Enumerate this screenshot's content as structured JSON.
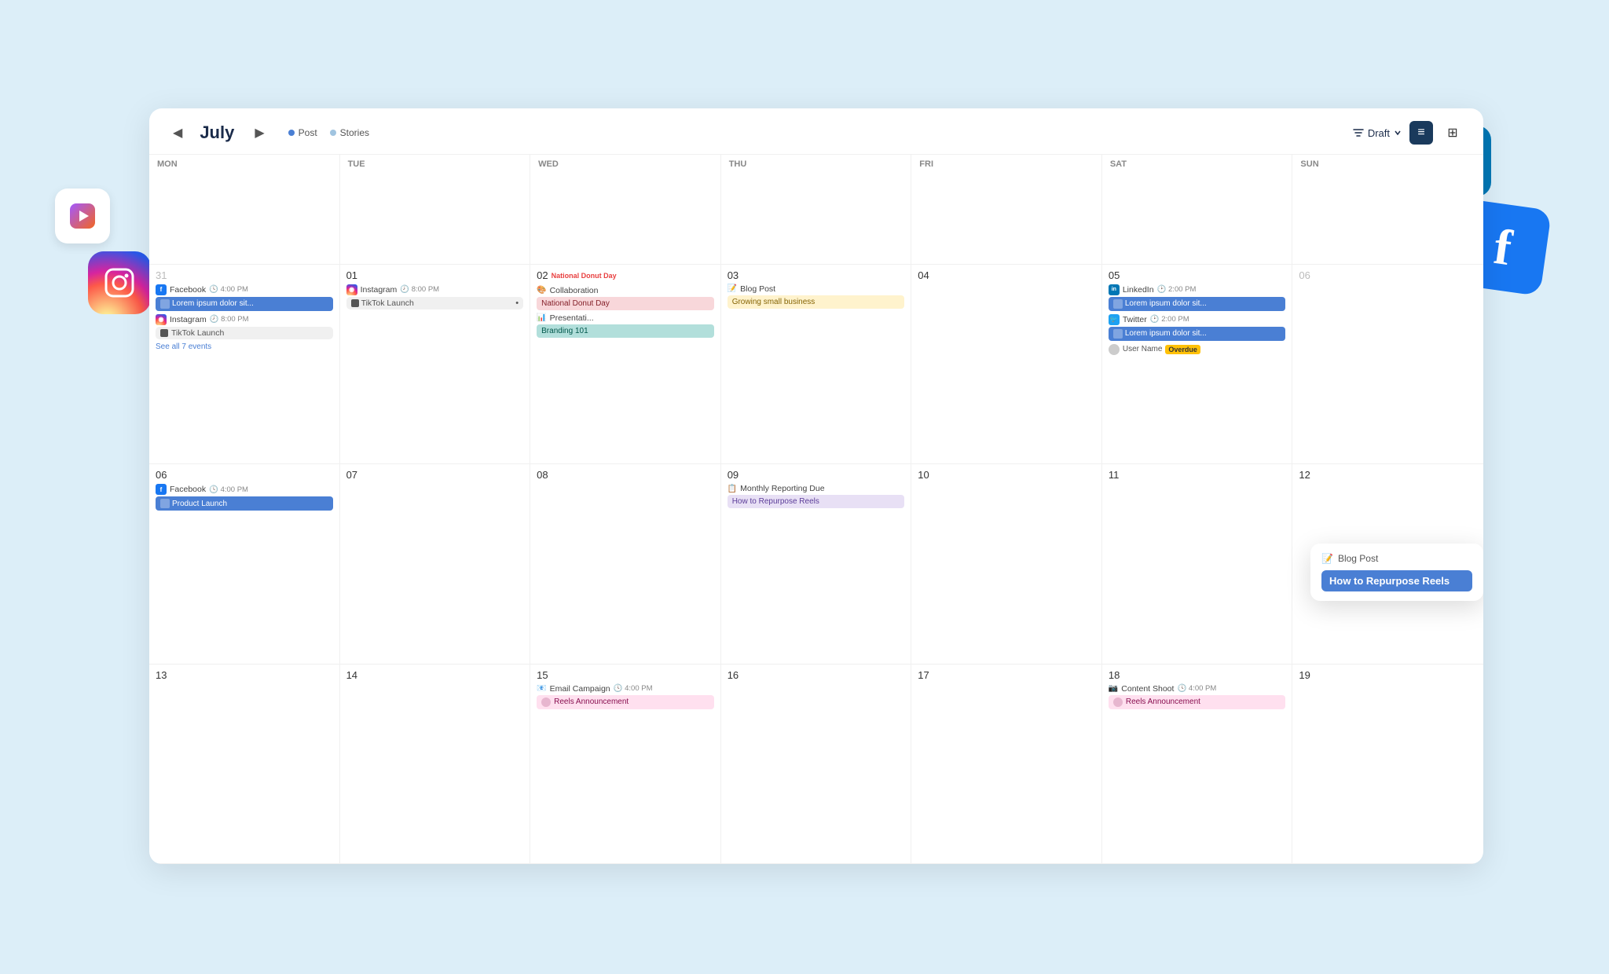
{
  "page": {
    "bg_color": "#dceef8"
  },
  "header": {
    "month": "July",
    "nav_prev": "◀",
    "nav_next": "▶",
    "legend": [
      {
        "label": "Post",
        "color": "#4a7fd4"
      },
      {
        "label": "Stories",
        "color": "#a0c4e0"
      }
    ],
    "filter_label": "Draft",
    "view_list": "≡",
    "view_grid": "⊞"
  },
  "days_of_week": [
    "Mon",
    "Tue",
    "Wed",
    "Thu",
    "Fri",
    "Sat",
    "Sun"
  ],
  "calendar": {
    "week1": {
      "mon": {
        "num": "31",
        "muted": true,
        "events": [
          {
            "platform": "Facebook",
            "time": "4:00 PM",
            "pill": "Lorem ipsum dolor sit...",
            "pill_type": "blue"
          },
          {
            "platform": "Instagram",
            "time": "8:00 PM"
          },
          {
            "subitem": "TikTok Launch"
          }
        ],
        "see_all": "See all 7 events"
      },
      "tue": {
        "num": "01",
        "events": [
          {
            "platform": "Instagram",
            "time": "8:00 PM"
          },
          {
            "subitem": "TikTok Launch",
            "has_dot": true
          }
        ]
      },
      "wed": {
        "num": "02",
        "holiday": "National Donut Day",
        "events": [
          {
            "platform_label": "Collaboration",
            "pill": "National Donut Day",
            "pill_type": "red"
          },
          {
            "platform_label": "Presentati...",
            "pill": "Branding 101",
            "pill_type": "teal"
          }
        ]
      },
      "thu": {
        "num": "03",
        "events": [
          {
            "platform_label": "Blog Post",
            "pill": "Growing small business",
            "pill_type": "yellow"
          }
        ]
      },
      "fri": {
        "num": "04",
        "events": []
      },
      "sat": {
        "num": "05",
        "events": [
          {
            "platform": "LinkedIn",
            "time": "2:00 PM",
            "pill": "Lorem ipsum dolor sit...",
            "pill_type": "blue"
          },
          {
            "platform": "Twitter",
            "time": "2:00 PM",
            "pill": "Lorem ipsum dolor sit...",
            "pill_type": "blue"
          },
          {
            "user": "User Name",
            "overdue": "Overdue"
          }
        ]
      },
      "sun": {
        "num": "06",
        "muted": true,
        "events": []
      }
    },
    "week2": {
      "mon": {
        "num": "06",
        "events": [
          {
            "platform": "Facebook",
            "time": "4:00 PM",
            "pill": "Product Launch",
            "pill_type": "blue"
          }
        ]
      },
      "tue": {
        "num": "07",
        "events": []
      },
      "wed": {
        "num": "08",
        "events": []
      },
      "thu": {
        "num": "09",
        "events": [
          {
            "platform_label": "Monthly Reporting Due",
            "pill": "How to Repurpose Reels",
            "pill_type": "lavender"
          }
        ]
      },
      "fri": {
        "num": "10",
        "events": []
      },
      "sat": {
        "num": "11",
        "events": []
      },
      "sun": {
        "num": "12",
        "events": []
      }
    },
    "week3": {
      "mon": {
        "num": "13",
        "events": []
      },
      "tue": {
        "num": "14",
        "events": []
      },
      "wed": {
        "num": "15",
        "events": [
          {
            "platform": "Email Campaign",
            "time": "4:00 PM",
            "pill": "Reels Announcement",
            "pill_type": "pink"
          }
        ]
      },
      "thu": {
        "num": "16",
        "events": []
      },
      "fri": {
        "num": "17",
        "events": []
      },
      "sat": {
        "num": "18",
        "events": [
          {
            "platform": "Content Shoot",
            "time": "4:00 PM",
            "pill": "Reels Announcement",
            "pill_type": "pink"
          }
        ]
      },
      "sun": {
        "num": "19",
        "events": []
      }
    }
  },
  "popup": {
    "header": "Blog Post",
    "title": "How to Repurpose Reels"
  },
  "social_icons": {
    "reels_label": "▶",
    "instagram_label": "📷",
    "tiktok_label": "♪",
    "linkedin_label": "in",
    "facebook_label": "f"
  }
}
